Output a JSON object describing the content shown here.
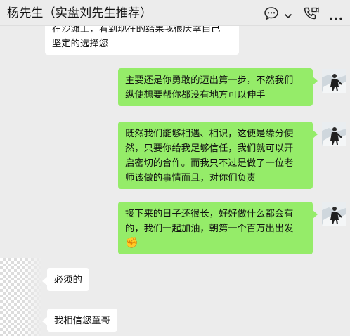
{
  "header": {
    "title": "杨先生（实盘刘先生推荐）",
    "icons": [
      "chat-more-icon",
      "chevron-down-icon",
      "phone-video-icon",
      "more-icon"
    ]
  },
  "messages": [
    {
      "side": "left",
      "lines": [
        "在沙滩上，看到现在的结果我很庆幸自己",
        "坚定的选择您"
      ]
    },
    {
      "side": "right",
      "lines": [
        "主要还是你勇敢的迈出第一步，不然我们",
        "纵使想要帮你都没有地方可以伸手"
      ]
    },
    {
      "side": "right",
      "lines": [
        "既然我们能够相遇、相识，这便是缘分使",
        "然，只要你给我足够信任，我们就可以开",
        "启密切的合作。而我只不过是做了一位老",
        "师该做的事情而且，对你们负责"
      ]
    },
    {
      "side": "right",
      "lines": [
        "接下来的日子还很长，好好做什么都会有",
        "的，我们一起加油，朝第一个百万出出发"
      ],
      "emoji": "✊"
    },
    {
      "side": "left",
      "lines": [
        "必须的"
      ]
    },
    {
      "side": "left",
      "lines": [
        "我相信您童哥"
      ]
    }
  ],
  "colors": {
    "background": "#ececec",
    "bubble_self": "#95ec69",
    "bubble_other": "#ffffff"
  }
}
